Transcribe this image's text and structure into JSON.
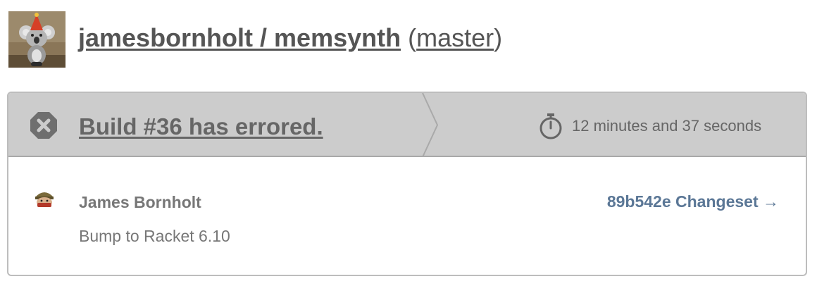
{
  "header": {
    "repo": "jamesbornholt / memsynth",
    "open_paren": "(",
    "branch": "master",
    "close_paren": ")"
  },
  "build": {
    "status_text": "Build #36 has errored.",
    "duration": "12 minutes and 37 seconds",
    "status_color": "#666666",
    "status_icon": "error-x-icon",
    "timer_icon": "stopwatch-icon"
  },
  "commit": {
    "author": "James Bornholt",
    "message": "Bump to Racket 6.10",
    "changeset": "89b542e Changeset →",
    "link_color": "#5b7796"
  }
}
